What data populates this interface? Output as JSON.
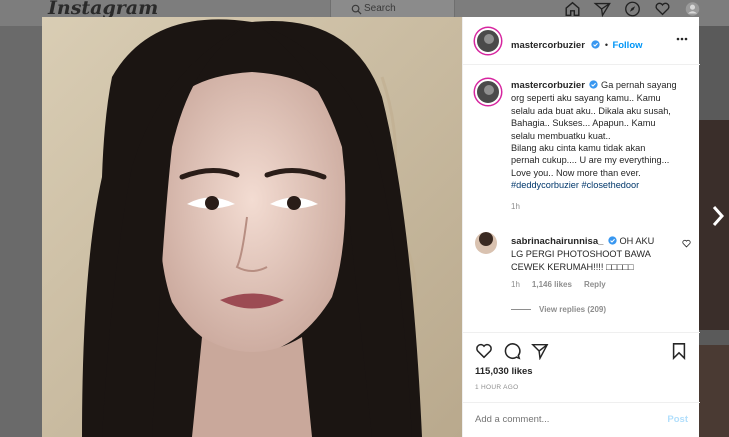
{
  "topbar": {
    "brand": "Instagram",
    "search_placeholder": "Search",
    "nav_icons": [
      "home-icon",
      "direct-icon",
      "explore-icon",
      "activity-icon",
      "profile-icon"
    ]
  },
  "post": {
    "username": "mastercorbuzier",
    "follow_label": "Follow",
    "separator": "•",
    "caption": {
      "author": "mastercorbuzier",
      "lines": [
        "Ga pernah sayang",
        "org seperti aku sayang kamu.. Kamu",
        "selalu ada buat aku.. Dikala aku susah,",
        "Bahagia.. Sukses... Apapun.. Kamu",
        "selalu membuatku kuat..",
        "Bilang aku cinta kamu tidak akan",
        "pernah cukup.... U are my everything...",
        "Love you.. Now more than ever."
      ],
      "hashtags": "#deddycorbuzier #closethedoor",
      "time": "1h"
    },
    "comment": {
      "author": "sabrinachairunnisa_",
      "text_line1": "OH AKU",
      "text_line2": "LG PERGI PHOTOSHOOT BAWA",
      "text_line3": "CEWEK KERUMAH!!!! □□□□□",
      "time": "1h",
      "likes": "1,146 likes",
      "reply_label": "Reply",
      "view_replies": "View replies (209)"
    },
    "likes_count": "115,030 likes",
    "time_ago": "1 HOUR AGO",
    "add_comment_placeholder": "Add a comment...",
    "post_label": "Post"
  },
  "colors": {
    "accent": "#0095f6",
    "hashtag": "#00376b",
    "muted": "#8e8e8e",
    "overlay": "#5a5a5a"
  }
}
